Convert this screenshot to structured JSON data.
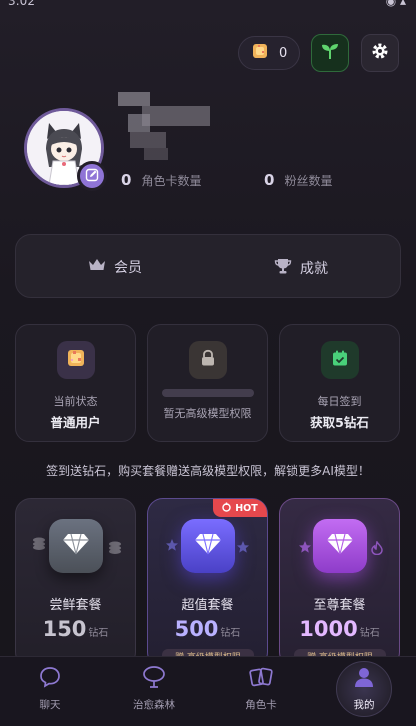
{
  "status": {
    "time": "3:02",
    "icons": "◉ ▴"
  },
  "topbar": {
    "diamond_count": "0"
  },
  "profile": {
    "role_cards_count": "0",
    "role_cards_label": "角色卡数量",
    "fans_count": "0",
    "fans_label": "粉丝数量"
  },
  "member": {
    "vip_label": "会员",
    "achievements_label": "成就"
  },
  "info_cards": [
    {
      "label": "当前状态",
      "value": "普通用户"
    },
    {
      "label": "暂无高级模型权限",
      "value": ""
    },
    {
      "label": "每日签到",
      "value": "获取5钻石"
    }
  ],
  "promo_text": "签到送钻石，购买套餐赠送高级模型权限，解锁更多AI模型！",
  "packages": [
    {
      "name": "尝鲜套餐",
      "amount": "150",
      "unit": "钻石",
      "color": "#c7c4cf",
      "tag": ""
    },
    {
      "name": "超值套餐",
      "amount": "500",
      "unit": "钻石",
      "color": "#b9b1ff",
      "tag": "赠·高级模型权限"
    },
    {
      "name": "至尊套餐",
      "amount": "1000",
      "unit": "钻石",
      "color": "#e3b8ff",
      "tag": "赠·高级模型权限"
    }
  ],
  "hot_label": "HOT",
  "nav": [
    {
      "label": "聊天"
    },
    {
      "label": "治愈森林"
    },
    {
      "label": "角色卡"
    },
    {
      "label": "我的"
    }
  ]
}
